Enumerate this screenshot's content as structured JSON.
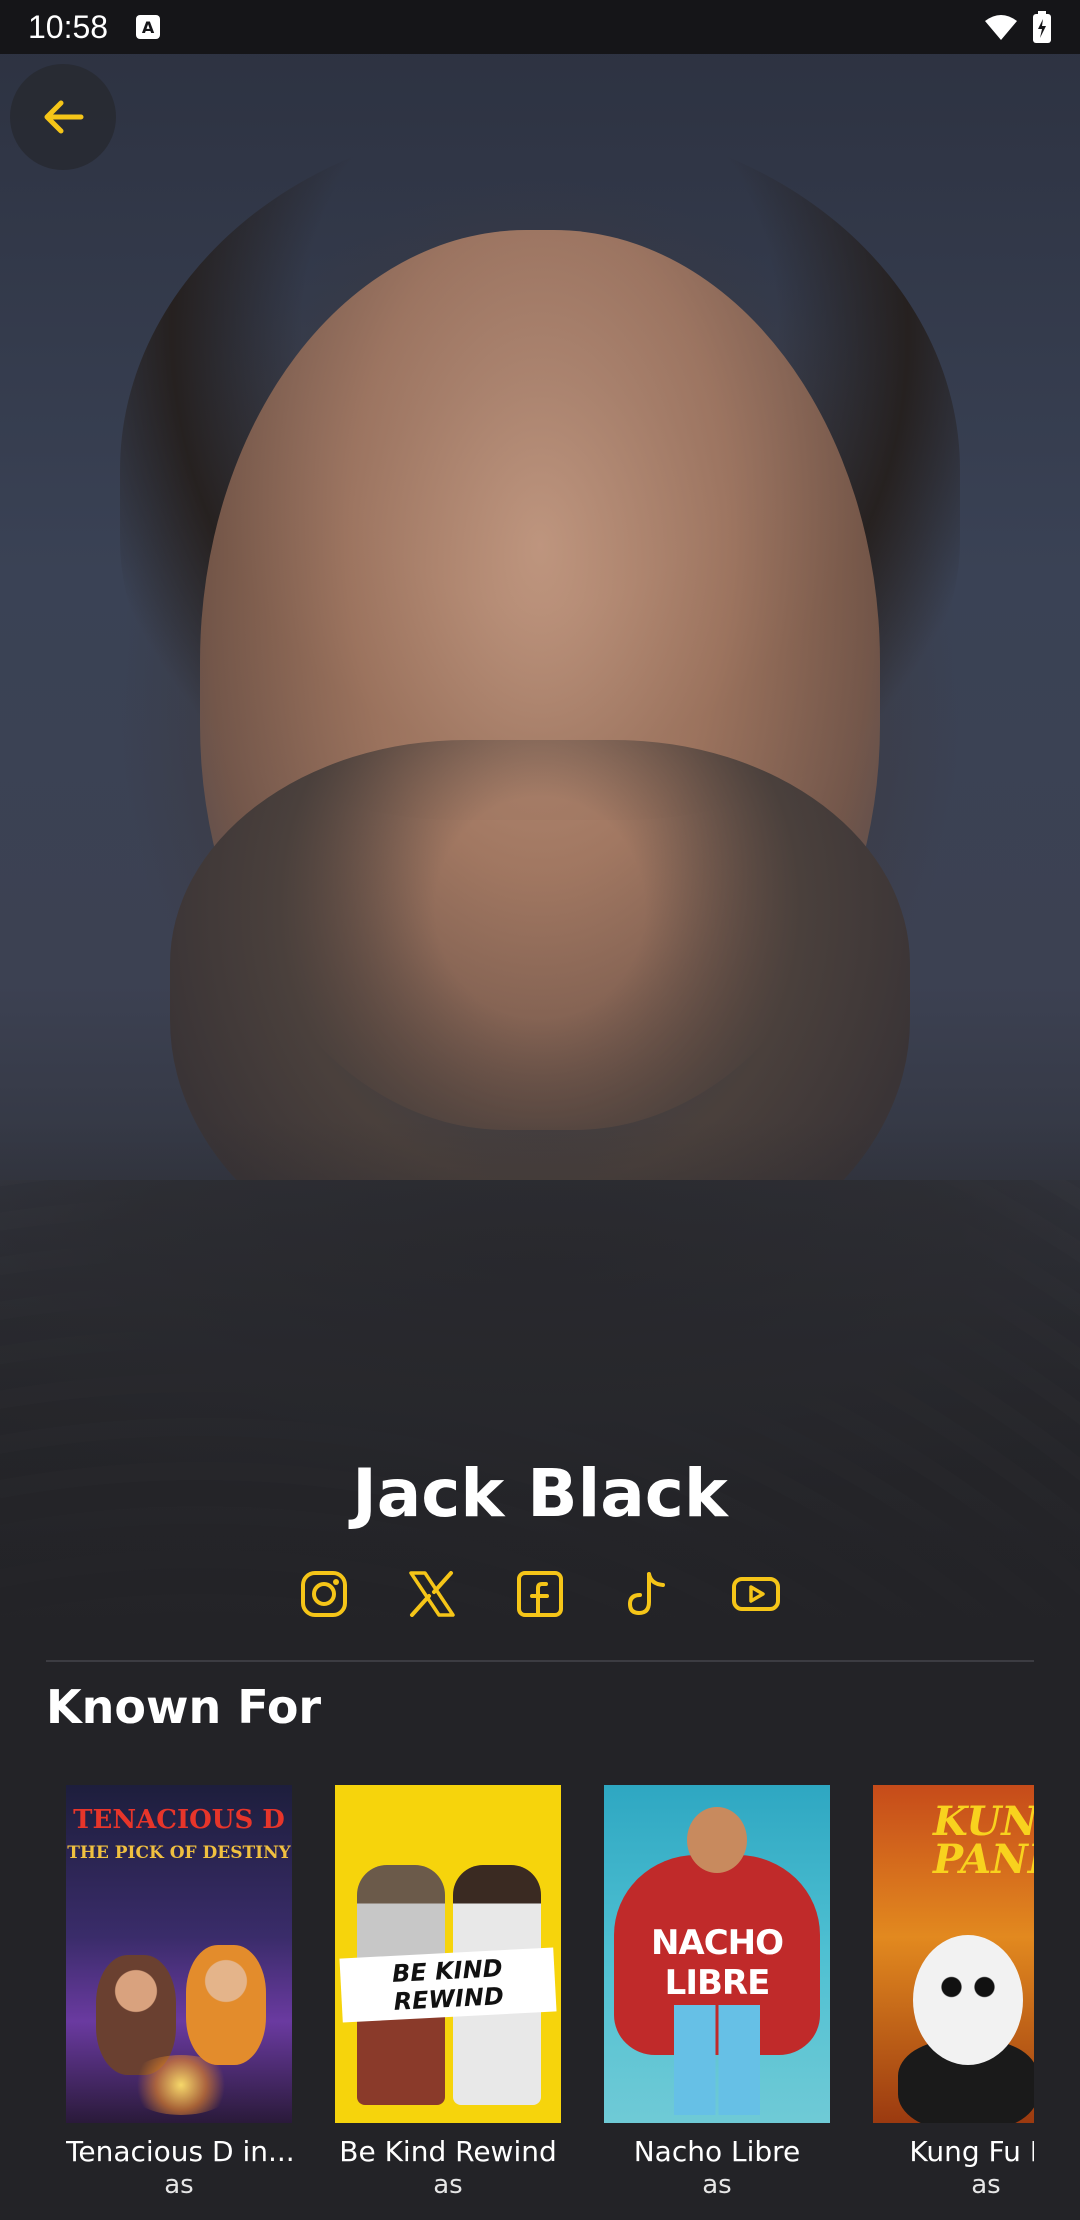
{
  "status_bar": {
    "time": "10:58",
    "notification_icon": "A"
  },
  "header": {
    "back_icon": "arrow-left-icon"
  },
  "person": {
    "name": "Jack Black"
  },
  "socials": [
    {
      "name": "instagram-icon"
    },
    {
      "name": "x-icon"
    },
    {
      "name": "facebook-icon"
    },
    {
      "name": "tiktok-icon"
    },
    {
      "name": "youtube-icon"
    }
  ],
  "known_for": {
    "title": "Known For",
    "items": [
      {
        "title": "Tenacious D in...",
        "role": "as",
        "poster_text": "TENACIOUS D",
        "poster_subtext": "THE PICK OF DESTINY"
      },
      {
        "title": "Be Kind Rewind",
        "role": "as",
        "poster_text": "BE KIND REWIND"
      },
      {
        "title": "Nacho Libre",
        "role": "as",
        "poster_text": "NACHO LIBRE"
      },
      {
        "title": "Kung Fu Pa",
        "role": "as",
        "poster_text": "KUNG F\nPAND"
      }
    ]
  },
  "colors": {
    "accent": "#F5C518",
    "background": "#232327",
    "status_bar": "#151518"
  }
}
